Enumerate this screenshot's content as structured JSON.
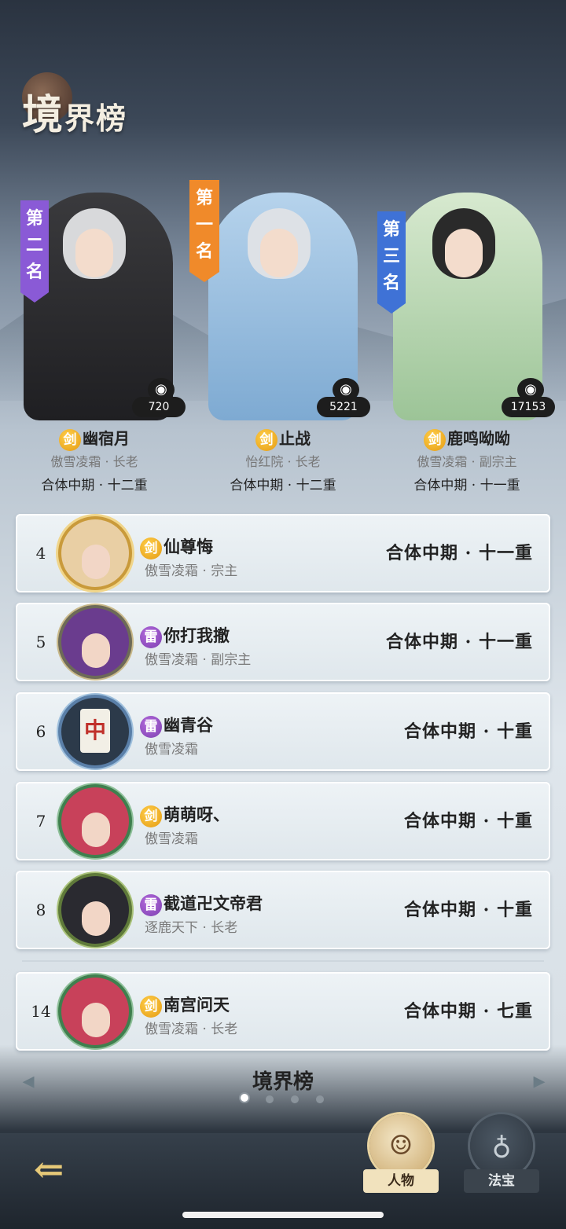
{
  "header": {
    "title_big": "境",
    "title_rest": "界榜"
  },
  "top3": [
    {
      "banner": "第二名",
      "banner_color": "#8a5ad6",
      "name": "幽宿月",
      "element": "剑",
      "element_type": "sword",
      "sect": "傲雪凌霜 · 长老",
      "realm": "合体中期 · 十二重",
      "power": "720",
      "outfit_color": "#2b2b2e",
      "hair_color": "#d9dadc"
    },
    {
      "banner": "第一名",
      "banner_color": "#f08a2a",
      "name": "止战",
      "element": "剑",
      "element_type": "sword",
      "sect": "怡红院 · 长老",
      "realm": "合体中期 · 十二重",
      "power": "5221",
      "outfit_color": "#8fb9de",
      "hair_color": "#d9dde2"
    },
    {
      "banner": "第三名",
      "banner_color": "#3f72d6",
      "name": "鹿鸣呦呦",
      "element": "剑",
      "element_type": "sword",
      "sect": "傲雪凌霜 · 副宗主",
      "realm": "合体中期 · 十一重",
      "power": "17153",
      "outfit_color": "#a8cfa2",
      "hair_color": "#262626"
    }
  ],
  "ranking": [
    {
      "rank": "4",
      "element": "剑",
      "element_type": "sword",
      "name": "仙尊悔",
      "sect": "傲雪凌霜 · 宗主",
      "realm": "合体中期 · 十一重",
      "hair": "#e9cfa4"
    },
    {
      "rank": "5",
      "element": "雷",
      "element_type": "thunder",
      "name": "你打我撤",
      "sect": "傲雪凌霜 · 副宗主",
      "realm": "合体中期 · 十一重",
      "hair": "#6a3c8e"
    },
    {
      "rank": "6",
      "element": "雷",
      "element_type": "thunder",
      "name": "幽青谷",
      "sect": "傲雪凌霜",
      "realm": "合体中期 · 十重",
      "hair": "#2c3a4a",
      "avatar_glyph": "中"
    },
    {
      "rank": "7",
      "element": "剑",
      "element_type": "sword",
      "name": "萌萌呀、",
      "sect": "傲雪凌霜",
      "realm": "合体中期 · 十重",
      "hair": "#c8415a"
    },
    {
      "rank": "8",
      "element": "雷",
      "element_type": "thunder",
      "name": "截道卍文帝君",
      "sect": "逐鹿天下 · 长老",
      "realm": "合体中期 · 十重",
      "hair": "#2a2a30"
    },
    {
      "rank": "14",
      "element": "剑",
      "element_type": "sword",
      "name": "南宫问天",
      "sect": "傲雪凌霜 · 长老",
      "realm": "合体中期 · 七重",
      "hair": "#c8415a"
    }
  ],
  "pager": {
    "title": "境界榜",
    "total": 4,
    "active": 1
  },
  "bottom": {
    "back_icon": "back-arrow-icon",
    "tab_characters": "人物",
    "tab_treasure": "法宝"
  }
}
